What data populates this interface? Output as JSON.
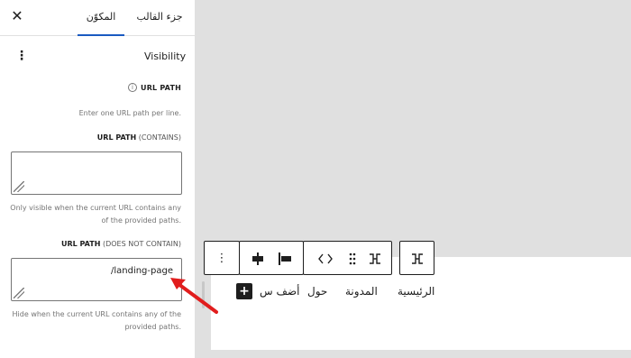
{
  "sidebar": {
    "close_icon": "close-icon",
    "tabs": [
      {
        "label": "المكوّن",
        "active": true
      },
      {
        "label": "جزء القالب",
        "active": false
      }
    ],
    "panel": {
      "title": "Visibility",
      "menu_icon": "vertical-dots-icon",
      "help_label": "URL PATH",
      "help_icon": "info-icon",
      "instructions": "Enter one URL path per line.",
      "contains": {
        "label_bold": "URL PATH",
        "label_rest": "(CONTAINS)",
        "value": "",
        "note": "Only visible when the current URL contains any of the provided paths."
      },
      "not_contains": {
        "label_bold": "URL PATH",
        "label_rest": "(DOES NOT CONTAIN)",
        "value": "/landing-page",
        "note": "Hide when the current URL contains any of the provided paths."
      }
    }
  },
  "toolbar": {
    "buttons": [
      "options-icon",
      "justify-center-icon",
      "justify-right-icon",
      "move-arrows-icon",
      "drag-handle-icon",
      "navigation-block-icon",
      "parent-block-icon"
    ]
  },
  "navigation": {
    "items": [
      "الرئيسية",
      "المدونة",
      "حول",
      "أضف س"
    ],
    "add_icon": "plus-icon"
  },
  "colors": {
    "accent": "#1a5ac1",
    "annotation_arrow": "#e11d1d"
  }
}
